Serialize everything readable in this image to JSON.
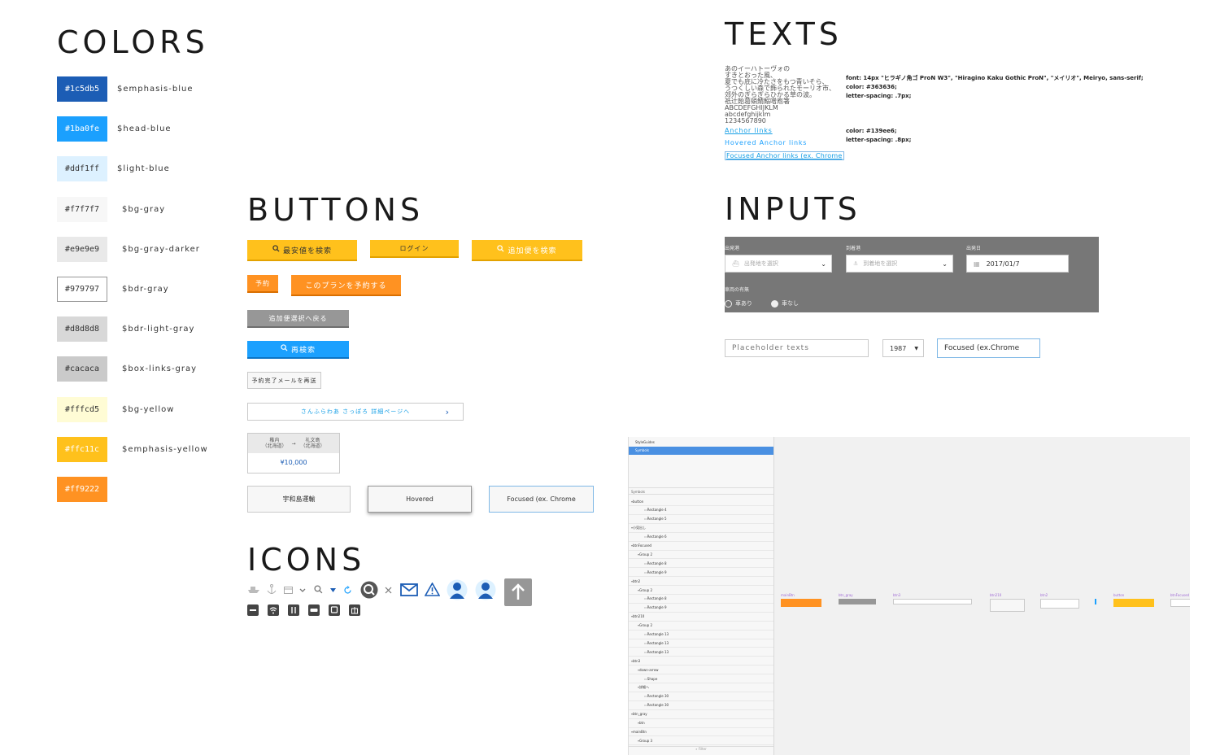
{
  "colors": {
    "title": "COLORS",
    "swatches": [
      {
        "hex": "#1c5db5",
        "name": "$emphasis-blue",
        "fg": "#ffffff"
      },
      {
        "hex": "#1ba0fe",
        "name": "$head-blue",
        "fg": "#ffffff"
      },
      {
        "hex": "#ddf1ff",
        "name": "$light-blue",
        "fg": "#333333"
      },
      {
        "hex": "#f7f7f7",
        "name": "$bg-gray",
        "fg": "#333333"
      },
      {
        "hex": "#e9e9e9",
        "name": "$bg-gray-darker",
        "fg": "#333333"
      },
      {
        "hex": "#979797",
        "name": "$bdr-gray",
        "fg": "#333333"
      },
      {
        "hex": "#d8d8d8",
        "name": "$bdr-light-gray",
        "fg": "#333333"
      },
      {
        "hex": "#cacaca",
        "name": "$box-links-gray",
        "fg": "#333333"
      },
      {
        "hex": "#fffcd5",
        "name": "$bg-yellow",
        "fg": "#333333"
      },
      {
        "hex": "#ffc11c",
        "name": "$emphasis-yellow",
        "fg": "#ffffff"
      },
      {
        "hex": "#ff9222",
        "name": "",
        "fg": "#ffffff"
      }
    ],
    "labels": [
      "#1c5db5",
      "#1ba0fe",
      "#ddf1ff",
      "#f7f7f7",
      "#e9e9e9",
      "#979797",
      "#d8d8d8",
      "#cacaca",
      "#fffcd5",
      "#ffc11c",
      "#ff9222"
    ]
  },
  "buttons": {
    "title": "BUTTONS",
    "search_cheapest": "最安値を検索",
    "login": "ログイン",
    "search_additional": "追加便を検索",
    "reserve": "予約",
    "reserve_plan": "このプランを予約する",
    "back_to_additional": "追加便選択へ戻る",
    "research": "再検索",
    "resend_mail": "予約完了メールを再送",
    "detail_link": "さんふらわあ さっぽろ 詳細ページへ",
    "route_from": "稚内",
    "route_from_sub": "（北海道）",
    "route_to": "礼文島",
    "route_to_sub": "（北海道）",
    "price": "¥10,000",
    "uwajima": "宇和島運輸",
    "hovered": "Hovered",
    "focused": "Focused (ex. Chrome"
  },
  "icons": {
    "title": "ICONS"
  },
  "texts": {
    "title": "TEXTS",
    "sample_lines": [
      "あのイーハトーヴォの",
      "すきとおった風、",
      "夏でも底に冷たさをもつ青いそら、",
      "うつくしい森で飾られたモーリオ市、",
      "郊外のぎらぎらひかる草の波。",
      "祇辻飴葛蛸鯖鰯噌庖箸",
      "ABCDEFGHIJKLM",
      "abcdefghijklm",
      "1234567890"
    ],
    "font_note_1": "font: 14px \"ヒラギノ角ゴ ProN W3\", \"Hiragino Kaku Gothic ProN\", \"メイリオ\", Meiryo, sans-serif;",
    "font_note_2": "color: #363636;",
    "font_note_3": "letter-spacing: .7px;",
    "anchor": "Anchor links",
    "anchor_hover": "Hovered Anchor links",
    "anchor_focus": "Focused Anchor links (ex. Chrome",
    "link_note_1": "color: #139ee6;",
    "link_note_2": "letter-spacing: .8px;"
  },
  "inputs": {
    "title": "INPUTS",
    "label_depart_port": "出発港",
    "label_arrive_port": "到着港",
    "label_depart_date": "出発日",
    "depart_placeholder": "出発地を選択",
    "arrive_placeholder": "到着地を選択",
    "date_value": "2017/01/7",
    "label_vehicle": "車両の有無",
    "radio_yes": "車あり",
    "radio_no": "車なし",
    "placeholder_text": "Placeholder texts",
    "year_value": "1987",
    "focused_value": "Focused (ex.Chrome"
  },
  "sketch": {
    "pages": [
      "StyleGuides",
      "Symbols"
    ],
    "layers_header": "Symbols",
    "layers": [
      {
        "indent": 0,
        "label": "button"
      },
      {
        "indent": 2,
        "label": "Rectangle 4"
      },
      {
        "indent": 2,
        "label": "Rectangle 5"
      },
      {
        "indent": 0,
        "label": "小見出し"
      },
      {
        "indent": 2,
        "label": "Rectangle 6"
      },
      {
        "indent": 0,
        "label": "btnFocused"
      },
      {
        "indent": 1,
        "label": "Group 2"
      },
      {
        "indent": 2,
        "label": "Rectangle 8"
      },
      {
        "indent": 2,
        "label": "Rectangle 9"
      },
      {
        "indent": 0,
        "label": "btn2"
      },
      {
        "indent": 1,
        "label": "Group 2"
      },
      {
        "indent": 2,
        "label": "Rectangle 8"
      },
      {
        "indent": 2,
        "label": "Rectangle 9"
      },
      {
        "indent": 0,
        "label": "btn210"
      },
      {
        "indent": 1,
        "label": "Group 2"
      },
      {
        "indent": 2,
        "label": "Rectangle 13"
      },
      {
        "indent": 2,
        "label": "Rectangle 13"
      },
      {
        "indent": 2,
        "label": "Rectangle 13"
      },
      {
        "indent": 0,
        "label": "btn3"
      },
      {
        "indent": 1,
        "label": "down-arrow"
      },
      {
        "indent": 2,
        "label": "Shape"
      },
      {
        "indent": 1,
        "label": "詳細へ"
      },
      {
        "indent": 2,
        "label": "Rectangle 30"
      },
      {
        "indent": 2,
        "label": "Rectangle 30"
      },
      {
        "indent": 0,
        "label": "btn_gray"
      },
      {
        "indent": 1,
        "label": "btn"
      },
      {
        "indent": 0,
        "label": "mainBtn"
      },
      {
        "indent": 1,
        "label": "Group 3"
      }
    ],
    "filter_placeholder": "Filter",
    "artboards": [
      {
        "label": "mainBtn",
        "color": "#ff9222"
      },
      {
        "label": "btn_gray",
        "color": "#979797"
      },
      {
        "label": "btn3",
        "color": "#ffffff"
      },
      {
        "label": "btn210",
        "color": "#f7f7f7"
      },
      {
        "label": "btn2",
        "color": "#ffffff"
      },
      {
        "label": "",
        "color": "#1ba0fe"
      },
      {
        "label": "button",
        "color": "#ffc11c"
      },
      {
        "label": "btnFocused",
        "color": "#ffffff"
      }
    ]
  }
}
